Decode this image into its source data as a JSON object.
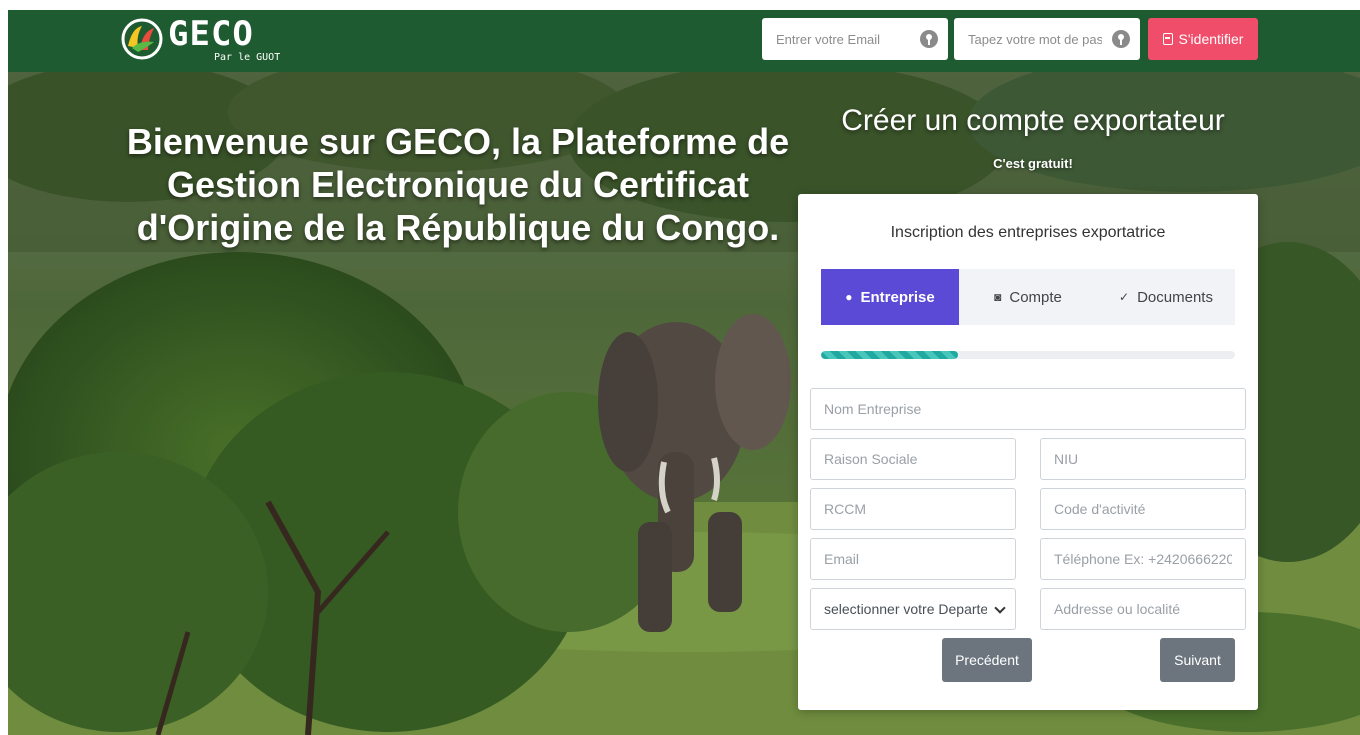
{
  "navbar": {
    "logo_text": "GECO",
    "logo_subtitle": "Par le GUOT",
    "email_placeholder": "Entrer votre Email",
    "password_placeholder": "Tapez votre mot de passe",
    "login_label": "S'identifier",
    "colors": {
      "background": "#1e5b30",
      "login_button": "#ef4d6a"
    }
  },
  "hero": {
    "title": "Bienvenue sur GECO, la Plateforme de Gestion Electronique du Certificat d'Origine de la République du Congo.",
    "signup_title": "Créer un compte exportateur",
    "signup_subtitle": "C'est gratuit!"
  },
  "form": {
    "card_title": "Inscription des entreprises exportatrice",
    "tabs": [
      {
        "label": "Entreprise",
        "icon": "user-circle-icon",
        "active": true
      },
      {
        "label": "Compte",
        "icon": "settings-circle-icon",
        "active": false
      },
      {
        "label": "Documents",
        "icon": "check-circle-icon",
        "active": false
      }
    ],
    "progress_percent": 33,
    "fields": {
      "nom_entreprise": "Nom Entreprise",
      "raison_sociale": "Raison Sociale",
      "niu": "NIU",
      "rccm": "RCCM",
      "code_activite": "Code d'activité",
      "email": "Email",
      "telephone": "Téléphone Ex: +2420666220",
      "departement_selected": "selectionner votre Departement",
      "adresse": "Addresse ou localité"
    },
    "buttons": {
      "previous": "Precédent",
      "next": "Suivant"
    },
    "colors": {
      "active_tab": "#5b4ad6",
      "progress": "#20a9a0",
      "button": "#6c757d"
    }
  }
}
